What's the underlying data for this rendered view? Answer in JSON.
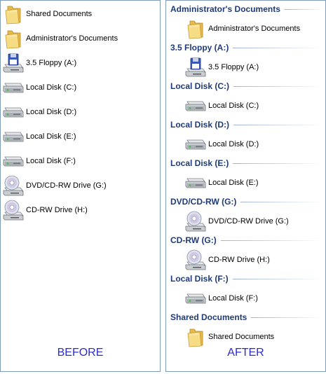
{
  "before": {
    "caption": "BEFORE",
    "items": [
      {
        "label": "Shared Documents",
        "icon": "folder-icon"
      },
      {
        "label": "Administrator's Documents",
        "icon": "folder-icon"
      },
      {
        "label": "3.5 Floppy (A:)",
        "icon": "floppy-drive-icon"
      },
      {
        "label": "Local Disk (C:)",
        "icon": "hard-disk-icon"
      },
      {
        "label": "Local Disk (D:)",
        "icon": "hard-disk-icon"
      },
      {
        "label": "Local Disk (E:)",
        "icon": "hard-disk-icon"
      },
      {
        "label": "Local Disk (F:)",
        "icon": "hard-disk-icon"
      },
      {
        "label": "DVD/CD-RW Drive (G:)",
        "icon": "cd-drive-icon"
      },
      {
        "label": "CD-RW Drive (H:)",
        "icon": "cd-drive-icon"
      }
    ]
  },
  "after": {
    "caption": "AFTER",
    "groups": [
      {
        "header": "Administrator's Documents",
        "item": "Administrator's Documents",
        "icon": "folder-icon"
      },
      {
        "header": "3.5 Floppy (A:)",
        "item": "3.5 Floppy (A:)",
        "icon": "floppy-drive-icon"
      },
      {
        "header": "Local Disk (C:)",
        "item": "Local Disk (C:)",
        "icon": "hard-disk-icon"
      },
      {
        "header": "Local Disk (D:)",
        "item": "Local Disk (D:)",
        "icon": "hard-disk-icon"
      },
      {
        "header": "Local Disk (E:)",
        "item": "Local Disk (E:)",
        "icon": "hard-disk-icon"
      },
      {
        "header": "DVD/CD-RW (G:)",
        "item": "DVD/CD-RW Drive (G:)",
        "icon": "cd-drive-icon"
      },
      {
        "header": "CD-RW (G:)",
        "item": "CD-RW Drive (H:)",
        "icon": "cd-drive-icon"
      },
      {
        "header": "Local Disk (F:)",
        "item": "Local Disk (F:)",
        "icon": "hard-disk-icon"
      },
      {
        "header": "Shared Documents",
        "item": "Shared Documents",
        "icon": "folder-icon"
      }
    ]
  },
  "colors": {
    "header_text": "#1f3a7a",
    "caption_text": "#2b2bd1",
    "panel_border": "#7f9db9"
  }
}
